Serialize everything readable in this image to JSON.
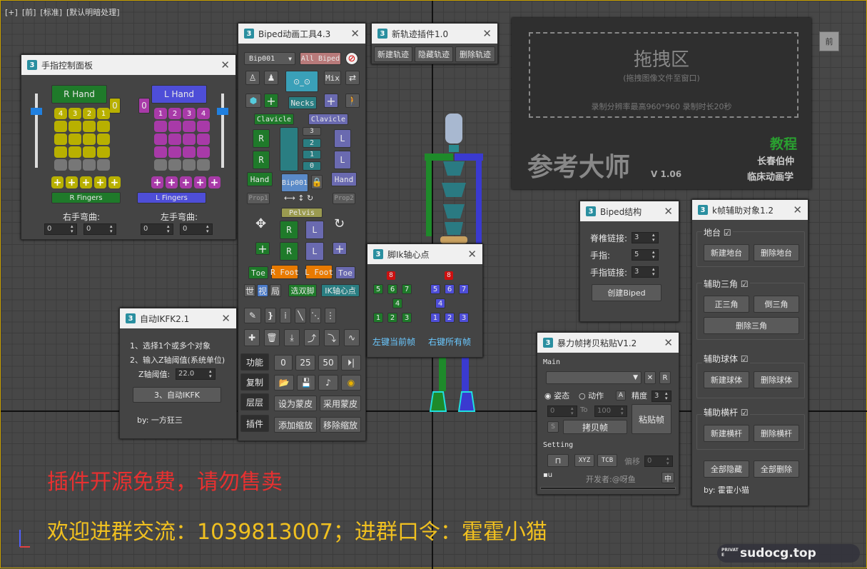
{
  "viewport": {
    "labels": [
      "[+]",
      "[前]",
      "[标准]",
      "[默认明暗处理]"
    ],
    "cube_label": "前"
  },
  "finger_panel": {
    "title": "手指控制面板",
    "r_hand": "R Hand",
    "l_hand": "L Hand",
    "r_nums": [
      "4",
      "3",
      "2",
      "1",
      "0"
    ],
    "l_nums": [
      "0",
      "1",
      "2",
      "3",
      "4"
    ],
    "r_fingers": "R Fingers",
    "l_fingers": "L Fingers",
    "right_curl": "右手弯曲:",
    "left_curl": "左手弯曲:",
    "spin_val": "0"
  },
  "biped_tool": {
    "title": "Biped动画工具4.3",
    "bip_select": "Bip001",
    "all_biped": "All Biped",
    "mix": "Mix",
    "necks": "Necks",
    "clavicle": "Clavicle",
    "r": "R",
    "l": "L",
    "spine_nums": [
      "3",
      "2",
      "1",
      "0"
    ],
    "hand": "Hand",
    "bip001": "Bip001",
    "prop1": "Prop1",
    "prop2": "Prop2",
    "pelvis": "Pelvis",
    "toe": "Toe",
    "r_foot": "R Foot",
    "l_foot": "L Foot",
    "row_shi": "世",
    "row_shi2": "视",
    "row_ju": "局",
    "xuan": "选双脚",
    "ik": "IK轴心点",
    "tabs": [
      "功能",
      "复制",
      "层层",
      "插件"
    ],
    "nums": [
      "0",
      "25",
      "50"
    ],
    "skin1": "设为蒙皮",
    "skin2": "采用蒙皮",
    "scale1": "添加缩放",
    "scale2": "移除缩放"
  },
  "track_plugin": {
    "title": "新轨迹插件1.0",
    "buttons": [
      "新建轨迹",
      "隐藏轨迹",
      "删除轨迹"
    ]
  },
  "drag_panel": {
    "title": "拖拽区",
    "sub": "(拖拽图像文件至窗口)",
    "note": "录制分辨率最高960*960 录制时长20秒",
    "brand": "参考大师",
    "version": "V 1.06",
    "tutorial": "教程",
    "author1": "长春伯仲",
    "author2": "临床动画学"
  },
  "ikfk": {
    "title": "自动IKFK2.1",
    "step1": "1、选择1个或多个对象",
    "step2": "2、输入Z轴阈值(系统单位)",
    "z_label": "Z轴阈值:",
    "z_val": "22.0",
    "step3": "3、自动IKFK",
    "by": "by: 一方狂三"
  },
  "foot_ik": {
    "title": "脚Ik轴心点",
    "nums_top": "8",
    "row1": [
      "5",
      "6",
      "7"
    ],
    "mid": "4",
    "row3": [
      "1",
      "2",
      "3"
    ],
    "left_btn": "左键当前帧",
    "right_btn": "右键所有帧"
  },
  "biped_struct": {
    "title": "Biped结构",
    "spine": "脊椎链接:",
    "spine_val": "3",
    "fingers": "手指:",
    "fingers_val": "5",
    "fingerlinks": "手指链接:",
    "fingerlinks_val": "3",
    "create": "创建Biped"
  },
  "kframe": {
    "title": "k帧辅助对象1.2",
    "platform": "地台",
    "new_platform": "新建地台",
    "del_platform": "删除地台",
    "tri": "辅助三角",
    "tri1": "正三角",
    "tri2": "倒三角",
    "del_tri": "删除三角",
    "sphere": "辅助球体",
    "new_sphere": "新建球体",
    "del_sphere": "删除球体",
    "bar": "辅助横杆",
    "new_bar": "新建横杆",
    "del_bar": "删除横杆",
    "hide_all": "全部隐藏",
    "del_all": "全部删除",
    "by": "by: 霍霍小猫"
  },
  "copy_paste": {
    "title": "暴力帧拷贝粘贴V1.2",
    "main": "Main",
    "pose": "姿态",
    "action": "动作",
    "a": "A",
    "precision": "精度",
    "precision_val": "3",
    "from": "0",
    "to": "To",
    "to_val": "100",
    "s": "S",
    "copy": "拷贝帧",
    "paste": "粘贴帧",
    "setting": "Setting",
    "xyz": "XYZ",
    "tcb": "TCB",
    "offset": "偏移",
    "offset_val": "0",
    "u": "u",
    "dev": "开发者:@呀鱼",
    "zh": "中",
    "x": "✕",
    "r": "R"
  },
  "overlay": {
    "free": "插件开源免费，请勿售卖",
    "group": "欢迎进群交流：1039813007；进群口令：霍霍小猫",
    "site": "sudocg.top",
    "site_tag": "PRIVATE"
  }
}
